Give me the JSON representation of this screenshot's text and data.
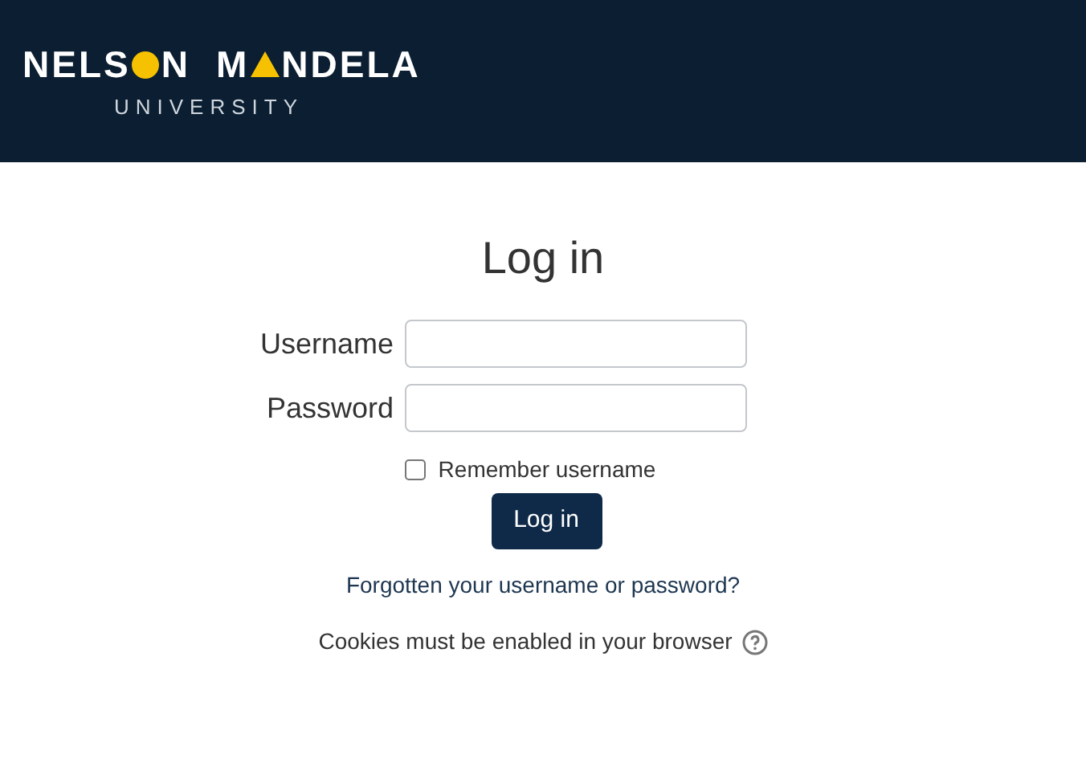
{
  "logo": {
    "word1_start": "NELS",
    "word1_end": "N",
    "word2_start": "M",
    "word2_end": "NDELA",
    "subtitle": "UNIVERSITY"
  },
  "title": "Log in",
  "fields": [
    {
      "label": "Username"
    },
    {
      "label": "Password"
    }
  ],
  "remember": {
    "label": "Remember username",
    "checked": false
  },
  "button": "Log in",
  "forgot_link": "Forgotten your username or password?",
  "cookies_note": "Cookies must be enabled in your browser"
}
